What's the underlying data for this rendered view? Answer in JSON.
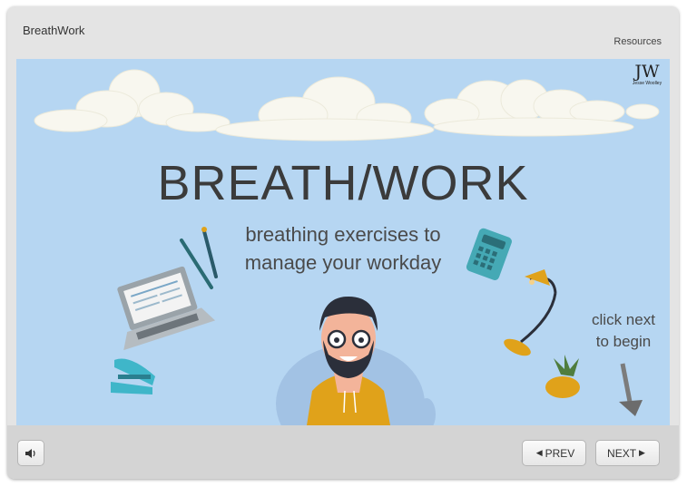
{
  "app": {
    "title": "BreathWork",
    "resources_label": "Resources"
  },
  "slide": {
    "logo_mark": "JW",
    "logo_name": "Jesse Woolley",
    "title": "BREATH/WORK",
    "subtitle_line1": "breathing exercises to",
    "subtitle_line2": "manage your workday",
    "hint_line1": "click next",
    "hint_line2": "to begin"
  },
  "controls": {
    "volume_icon": "speaker-icon",
    "prev_label": "PREV",
    "next_label": "NEXT"
  },
  "colors": {
    "slide_bg": "#b6d6f2",
    "chrome": "#e4e4e4",
    "footer": "#d4d4d4",
    "shirt": "#e0a21a"
  }
}
